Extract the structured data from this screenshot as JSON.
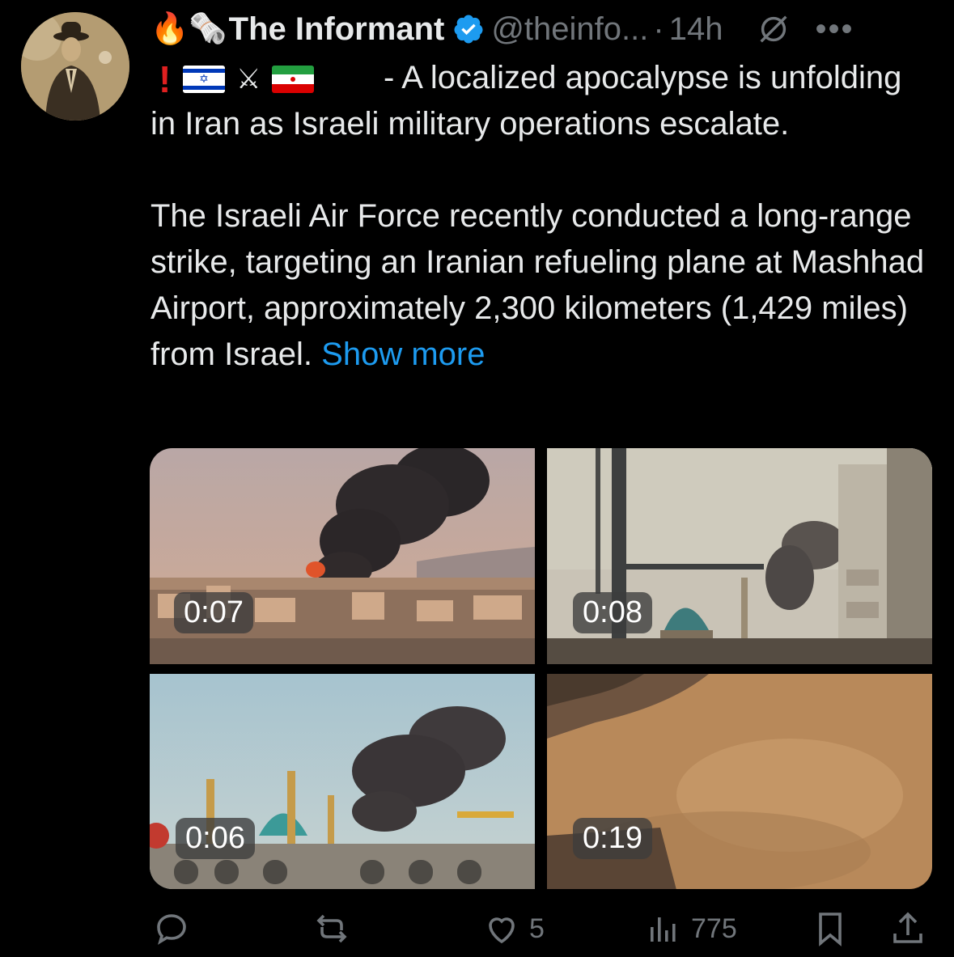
{
  "tweet": {
    "author_name": "The Informant",
    "handle": "@theinfo...",
    "separator": "·",
    "time": "14h",
    "more_label": "•••",
    "prefix_emoji": [
      "🔥",
      "🗞️"
    ],
    "flag_line_emoji": [
      "❗",
      "🇮🇱",
      "⚔️",
      "🇮🇷"
    ],
    "text_line1": "- A localized apocalypse is unfolding in Iran as Israeli military operations escalate.",
    "text_para2": "The Israeli Air Force recently conducted a long-range strike, targeting an Iranian refueling plane at Mashhad Airport, approximately 2,300 kilometers (1,429 miles) from Israel.",
    "show_more": "Show more"
  },
  "media": [
    {
      "duration": "0:07"
    },
    {
      "duration": "0:08"
    },
    {
      "duration": "0:06"
    },
    {
      "duration": "0:19"
    }
  ],
  "actions": {
    "reply_count": "",
    "repost_count": "",
    "like_count": "5",
    "views_count": "775"
  },
  "colors": {
    "background": "#000000",
    "text": "#e7e9ea",
    "muted": "#71767b",
    "link": "#1d9bf0",
    "verified": "#1d9bf0"
  },
  "icons": [
    "verified-badge-icon",
    "grok-icon",
    "more-icon",
    "reply-icon",
    "repost-icon",
    "like-icon",
    "views-icon",
    "bookmark-icon",
    "share-icon"
  ]
}
